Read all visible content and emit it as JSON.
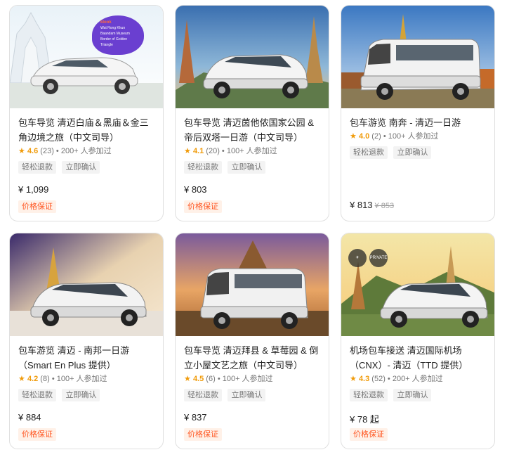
{
  "colors": {
    "accent": "#ff5722",
    "star": "#f09b0a",
    "tag_bg": "#f3f3f3",
    "badge_bg": "#fff1e8"
  },
  "cards": [
    {
      "title": "包车导览 清迈白庙＆黑庙＆金三角边境之旅（中文司导）",
      "rating": "4.6",
      "reviews": "(23)",
      "booked": "• 200+ 人参加过",
      "tags": [
        "轻松退款",
        "立即确认"
      ],
      "price": "¥ 1,099",
      "old_price": "",
      "price_badge": "价格保证",
      "promo": {
        "brand": "klook",
        "lines": [
          "Wat Rong Khun",
          "Baandam Museum",
          "Border of Golden Triangle"
        ]
      }
    },
    {
      "title": "包车导览 清迈茵他侬国家公园 & 帝后双塔一日游（中文司导）",
      "rating": "4.1",
      "reviews": "(20)",
      "booked": "• 100+ 人参加过",
      "tags": [
        "轻松退款",
        "立即确认"
      ],
      "price": "¥ 803",
      "old_price": "",
      "price_badge": "价格保证"
    },
    {
      "title": "包车游览 南奔 - 清迈一日游",
      "rating": "4.0",
      "reviews": "(2)",
      "booked": "• 100+ 人参加过",
      "tags": [
        "轻松退款",
        "立即确认"
      ],
      "price": "¥ 813",
      "old_price": "¥ 853",
      "price_badge": ""
    },
    {
      "title": "包车游览 清迈 - 南邦一日游（Smart En Plus 提供）",
      "rating": "4.2",
      "reviews": "(8)",
      "booked": "• 100+ 人参加过",
      "tags": [
        "轻松退款",
        "立即确认"
      ],
      "price": "¥ 884",
      "old_price": "",
      "price_badge": "价格保证"
    },
    {
      "title": "包车导览 清迈拜县 & 草莓园 & 倒立小屋文艺之旅（中文司导）",
      "rating": "4.5",
      "reviews": "(6)",
      "booked": "• 100+ 人参加过",
      "tags": [
        "轻松退款",
        "立即确认"
      ],
      "price": "¥ 837",
      "old_price": "",
      "price_badge": "价格保证"
    },
    {
      "title": "机场包车接送 清迈国际机场（CNX）- 清迈（TTD 提供）",
      "rating": "4.3",
      "reviews": "(52)",
      "booked": "• 200+ 人参加过",
      "tags": [
        "轻松退款",
        "立即确认"
      ],
      "price": "¥ 78 起",
      "old_price": "",
      "price_badge": "价格保证",
      "badges": [
        "PRIVATE"
      ]
    }
  ]
}
